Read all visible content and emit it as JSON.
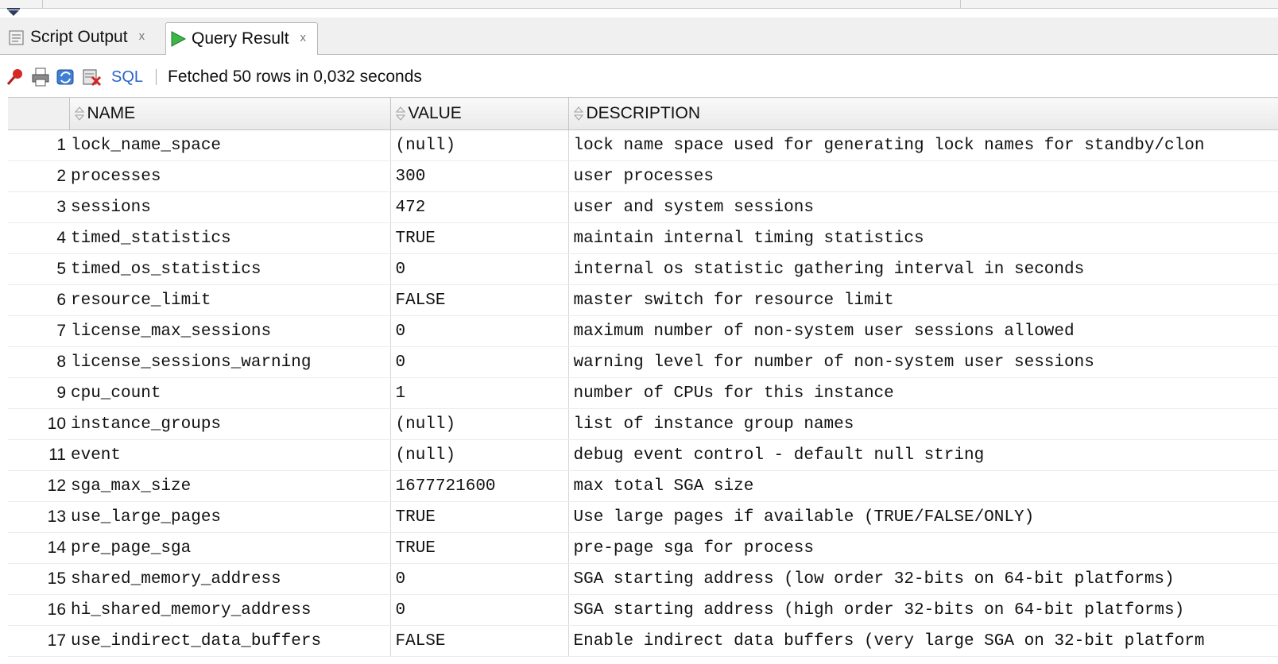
{
  "tabs": [
    {
      "label": "Script Output",
      "close": "x",
      "active": false
    },
    {
      "label": "Query Result",
      "close": "x",
      "active": true
    }
  ],
  "toolbar": {
    "icons": [
      "pin-icon",
      "print-icon",
      "refresh-icon",
      "clear-icon"
    ],
    "sql_label": "SQL",
    "status": "Fetched 50 rows in 0,032 seconds"
  },
  "grid": {
    "columns": [
      "NAME",
      "VALUE",
      "DESCRIPTION"
    ],
    "rows": [
      {
        "n": "1",
        "name": "lock_name_space",
        "value": "(null)",
        "desc": "lock name space used for generating lock names for standby/clon"
      },
      {
        "n": "2",
        "name": "processes",
        "value": "300",
        "desc": "user processes"
      },
      {
        "n": "3",
        "name": "sessions",
        "value": "472",
        "desc": "user and system sessions"
      },
      {
        "n": "4",
        "name": "timed_statistics",
        "value": "TRUE",
        "desc": "maintain internal timing statistics"
      },
      {
        "n": "5",
        "name": "timed_os_statistics",
        "value": "0",
        "desc": "internal os statistic gathering interval in seconds"
      },
      {
        "n": "6",
        "name": "resource_limit",
        "value": "FALSE",
        "desc": "master switch for resource limit"
      },
      {
        "n": "7",
        "name": "license_max_sessions",
        "value": "0",
        "desc": "maximum number of non-system user sessions allowed"
      },
      {
        "n": "8",
        "name": "license_sessions_warning",
        "value": "0",
        "desc": "warning level for number of non-system user sessions"
      },
      {
        "n": "9",
        "name": "cpu_count",
        "value": "1",
        "desc": "number of CPUs for this instance"
      },
      {
        "n": "10",
        "name": "instance_groups",
        "value": "(null)",
        "desc": "list of instance group names"
      },
      {
        "n": "11",
        "name": "event",
        "value": "(null)",
        "desc": "debug event control - default null string"
      },
      {
        "n": "12",
        "name": "sga_max_size",
        "value": "1677721600",
        "desc": "max total SGA size"
      },
      {
        "n": "13",
        "name": "use_large_pages",
        "value": "TRUE",
        "desc": "Use large pages if available (TRUE/FALSE/ONLY)"
      },
      {
        "n": "14",
        "name": "pre_page_sga",
        "value": "TRUE",
        "desc": "pre-page sga for process"
      },
      {
        "n": "15",
        "name": "shared_memory_address",
        "value": "0",
        "desc": "SGA starting address (low order 32-bits on 64-bit platforms)"
      },
      {
        "n": "16",
        "name": "hi_shared_memory_address",
        "value": "0",
        "desc": "SGA starting address (high order 32-bits on 64-bit platforms)"
      },
      {
        "n": "17",
        "name": "use_indirect_data_buffers",
        "value": "FALSE",
        "desc": "Enable indirect data buffers (very large SGA on 32-bit platform"
      }
    ]
  }
}
